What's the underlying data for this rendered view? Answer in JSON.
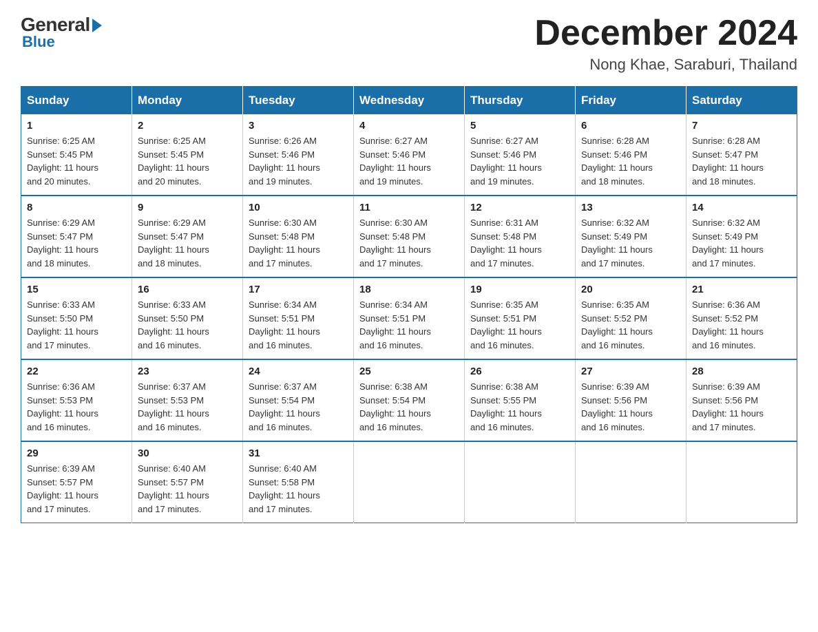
{
  "logo": {
    "general": "General",
    "blue": "Blue"
  },
  "title": "December 2024",
  "location": "Nong Khae, Saraburi, Thailand",
  "days_of_week": [
    "Sunday",
    "Monday",
    "Tuesday",
    "Wednesday",
    "Thursday",
    "Friday",
    "Saturday"
  ],
  "weeks": [
    [
      {
        "day": "1",
        "sunrise": "6:25 AM",
        "sunset": "5:45 PM",
        "daylight": "11 hours and 20 minutes."
      },
      {
        "day": "2",
        "sunrise": "6:25 AM",
        "sunset": "5:45 PM",
        "daylight": "11 hours and 20 minutes."
      },
      {
        "day": "3",
        "sunrise": "6:26 AM",
        "sunset": "5:46 PM",
        "daylight": "11 hours and 19 minutes."
      },
      {
        "day": "4",
        "sunrise": "6:27 AM",
        "sunset": "5:46 PM",
        "daylight": "11 hours and 19 minutes."
      },
      {
        "day": "5",
        "sunrise": "6:27 AM",
        "sunset": "5:46 PM",
        "daylight": "11 hours and 19 minutes."
      },
      {
        "day": "6",
        "sunrise": "6:28 AM",
        "sunset": "5:46 PM",
        "daylight": "11 hours and 18 minutes."
      },
      {
        "day": "7",
        "sunrise": "6:28 AM",
        "sunset": "5:47 PM",
        "daylight": "11 hours and 18 minutes."
      }
    ],
    [
      {
        "day": "8",
        "sunrise": "6:29 AM",
        "sunset": "5:47 PM",
        "daylight": "11 hours and 18 minutes."
      },
      {
        "day": "9",
        "sunrise": "6:29 AM",
        "sunset": "5:47 PM",
        "daylight": "11 hours and 18 minutes."
      },
      {
        "day": "10",
        "sunrise": "6:30 AM",
        "sunset": "5:48 PM",
        "daylight": "11 hours and 17 minutes."
      },
      {
        "day": "11",
        "sunrise": "6:30 AM",
        "sunset": "5:48 PM",
        "daylight": "11 hours and 17 minutes."
      },
      {
        "day": "12",
        "sunrise": "6:31 AM",
        "sunset": "5:48 PM",
        "daylight": "11 hours and 17 minutes."
      },
      {
        "day": "13",
        "sunrise": "6:32 AM",
        "sunset": "5:49 PM",
        "daylight": "11 hours and 17 minutes."
      },
      {
        "day": "14",
        "sunrise": "6:32 AM",
        "sunset": "5:49 PM",
        "daylight": "11 hours and 17 minutes."
      }
    ],
    [
      {
        "day": "15",
        "sunrise": "6:33 AM",
        "sunset": "5:50 PM",
        "daylight": "11 hours and 17 minutes."
      },
      {
        "day": "16",
        "sunrise": "6:33 AM",
        "sunset": "5:50 PM",
        "daylight": "11 hours and 16 minutes."
      },
      {
        "day": "17",
        "sunrise": "6:34 AM",
        "sunset": "5:51 PM",
        "daylight": "11 hours and 16 minutes."
      },
      {
        "day": "18",
        "sunrise": "6:34 AM",
        "sunset": "5:51 PM",
        "daylight": "11 hours and 16 minutes."
      },
      {
        "day": "19",
        "sunrise": "6:35 AM",
        "sunset": "5:51 PM",
        "daylight": "11 hours and 16 minutes."
      },
      {
        "day": "20",
        "sunrise": "6:35 AM",
        "sunset": "5:52 PM",
        "daylight": "11 hours and 16 minutes."
      },
      {
        "day": "21",
        "sunrise": "6:36 AM",
        "sunset": "5:52 PM",
        "daylight": "11 hours and 16 minutes."
      }
    ],
    [
      {
        "day": "22",
        "sunrise": "6:36 AM",
        "sunset": "5:53 PM",
        "daylight": "11 hours and 16 minutes."
      },
      {
        "day": "23",
        "sunrise": "6:37 AM",
        "sunset": "5:53 PM",
        "daylight": "11 hours and 16 minutes."
      },
      {
        "day": "24",
        "sunrise": "6:37 AM",
        "sunset": "5:54 PM",
        "daylight": "11 hours and 16 minutes."
      },
      {
        "day": "25",
        "sunrise": "6:38 AM",
        "sunset": "5:54 PM",
        "daylight": "11 hours and 16 minutes."
      },
      {
        "day": "26",
        "sunrise": "6:38 AM",
        "sunset": "5:55 PM",
        "daylight": "11 hours and 16 minutes."
      },
      {
        "day": "27",
        "sunrise": "6:39 AM",
        "sunset": "5:56 PM",
        "daylight": "11 hours and 16 minutes."
      },
      {
        "day": "28",
        "sunrise": "6:39 AM",
        "sunset": "5:56 PM",
        "daylight": "11 hours and 17 minutes."
      }
    ],
    [
      {
        "day": "29",
        "sunrise": "6:39 AM",
        "sunset": "5:57 PM",
        "daylight": "11 hours and 17 minutes."
      },
      {
        "day": "30",
        "sunrise": "6:40 AM",
        "sunset": "5:57 PM",
        "daylight": "11 hours and 17 minutes."
      },
      {
        "day": "31",
        "sunrise": "6:40 AM",
        "sunset": "5:58 PM",
        "daylight": "11 hours and 17 minutes."
      },
      null,
      null,
      null,
      null
    ]
  ]
}
